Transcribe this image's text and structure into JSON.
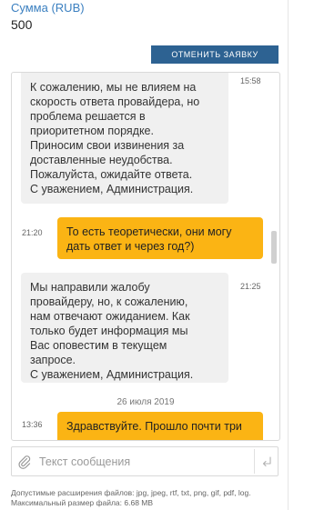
{
  "amount": {
    "label": "Сумма (RUB)",
    "value": "500"
  },
  "toolbar": {
    "cancel_label": "ОТМЕНИТЬ ЗАЯВКУ"
  },
  "chat": {
    "messages": [
      {
        "author": "admin",
        "time": "15:58",
        "text": "К сожалению, мы не влияем на\nскорость ответа провайдера, но\nпроблема решается в\nприоритетном порядке.\nПриносим свои извинения за\nдоставленные неудобства.\nПожалуйста, ожидайте ответа.\nС уважением, Администрация."
      },
      {
        "author": "user",
        "time": "21:20",
        "text": "То есть теоретически, они могу\nдать ответ и через год?)"
      },
      {
        "author": "admin",
        "time": "21:25",
        "text": "Мы направили жалобу\nпровайдеру, но, к сожалению,\nнам отвечают ожиданием. Как\nтолько будет информация мы\nВас оповестим в текущем\nзапросе.\nС уважением, Администрация."
      },
      {
        "author": "user",
        "time": "13:36",
        "text": "Здравствуйте. Прошло почти три"
      }
    ],
    "date_separators": [
      "26 июля 2019"
    ]
  },
  "composer": {
    "placeholder": "Текст сообщения"
  },
  "hints": {
    "extensions": "Допустимые расширения файлов: jpg, jpeg, rtf, txt, png, gif, pdf, log.",
    "max_size": "Максимальный размер файла: 6.68 MB"
  },
  "icons": {
    "attach": "paperclip-icon",
    "send": "enter-icon"
  },
  "colors": {
    "accent_link": "#3a7fc0",
    "button": "#2d6292",
    "user_bubble": "#fbb414",
    "admin_bubble": "#f0f0f0"
  }
}
